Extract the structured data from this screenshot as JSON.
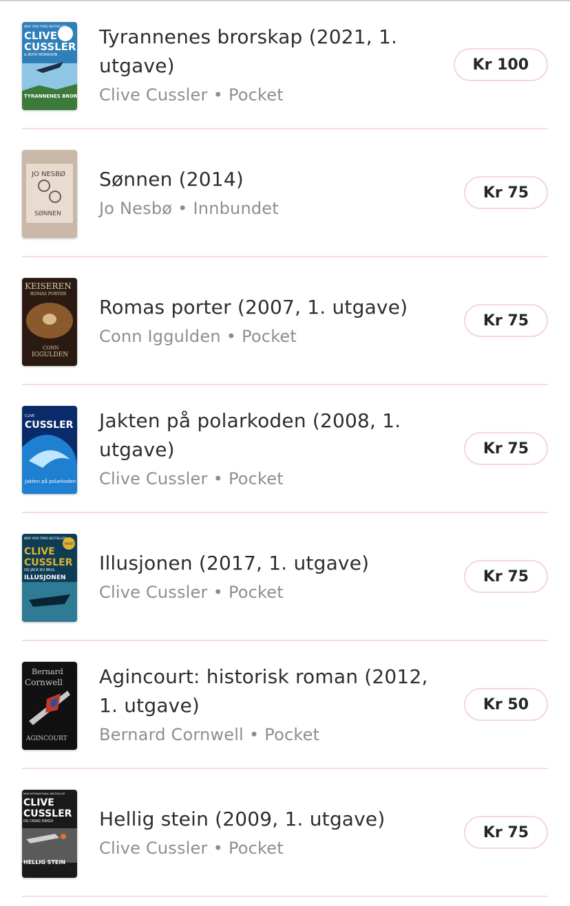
{
  "books": [
    {
      "title": "Tyrannenes brorskap (2021, 1. utgave)",
      "author": "Clive Cussler",
      "format": "Pocket",
      "price": "Kr 100",
      "cover": {
        "texts": [
          "NEW YORK TIMES BESTSELLER",
          "CLIVE",
          "CUSSLER",
          "& BOYD MORRISON",
          "TYRANNENES BRORSKAP"
        ],
        "colors": [
          "#2f7fb8",
          "#8fc6e6",
          "#3b7a3a"
        ]
      }
    },
    {
      "title": "Sønnen (2014)",
      "author": "Jo Nesbø",
      "format": "Innbundet",
      "price": "Kr 75",
      "cover": {
        "texts": [
          "JO NESBØ",
          "SØNNEN"
        ],
        "colors": [
          "#c9b8a8",
          "#e8dcd1",
          "#6a5a50"
        ]
      }
    },
    {
      "title": "Romas porter (2007, 1. utgave)",
      "author": "Conn Iggulden",
      "format": "Pocket",
      "price": "Kr 75",
      "cover": {
        "texts": [
          "KEISEREN",
          "ROMAS PORTER",
          "CONN",
          "IGGULDEN"
        ],
        "colors": [
          "#2b1a12",
          "#8a5a2e",
          "#d9b98a"
        ]
      }
    },
    {
      "title": "Jakten på polarkoden (2008, 1. utgave)",
      "author": "Clive Cussler",
      "format": "Pocket",
      "price": "Kr 75",
      "cover": {
        "texts": [
          "CLIVE",
          "CUSSLER",
          "Jakten på polarkoden"
        ],
        "colors": [
          "#0a2a6a",
          "#1f7fd0",
          "#bfe6ff"
        ]
      }
    },
    {
      "title": "Illusjonen (2017, 1. utgave)",
      "author": "Clive Cussler",
      "format": "Pocket",
      "price": "Kr 75",
      "cover": {
        "texts": [
          "NEW YORK TIMES BESTSELLER",
          "CLIVE",
          "CUSSLER",
          "OG JACK DU BRUL",
          "ILLUSJONEN",
          "NYHET"
        ],
        "colors": [
          "#0e3c55",
          "#2f7a94",
          "#e0b32e"
        ]
      }
    },
    {
      "title": "Agincourt: historisk roman (2012, 1. utgave)",
      "author": "Bernard Cornwell",
      "format": "Pocket",
      "price": "Kr 50",
      "cover": {
        "texts": [
          "Bernard",
          "Cornwell",
          "AGINCOURT"
        ],
        "colors": [
          "#111111",
          "#c0392b",
          "#c8c8c8"
        ]
      }
    },
    {
      "title": "Hellig stein (2009, 1. utgave)",
      "author": "Clive Cussler",
      "format": "Pocket",
      "price": "Kr 75",
      "cover": {
        "texts": [
          "NEW INTERNATIONAL BESTSELLER",
          "CLIVE",
          "CUSSLER",
          "OG CRAIG DIRGO",
          "HELLIG STEIN"
        ],
        "colors": [
          "#1a1a1a",
          "#5a5a5a",
          "#d0d0d0"
        ]
      }
    }
  ]
}
